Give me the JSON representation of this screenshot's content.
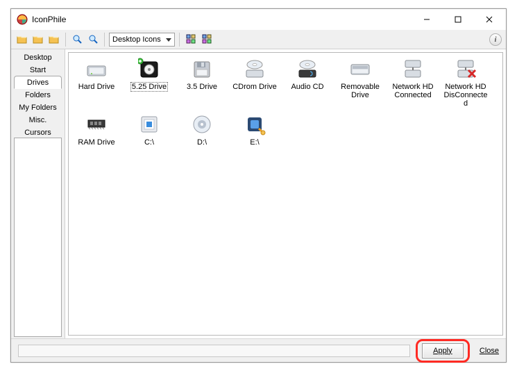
{
  "window": {
    "title": "IconPhile",
    "buttons": {
      "minimize": "Minimize",
      "maximize": "Maximize",
      "close": "Close"
    }
  },
  "toolbar": {
    "dropdown_value": "Desktop Icons",
    "help": "i",
    "icons": [
      "folder-open",
      "folder-open2",
      "folder-open3",
      "search",
      "magnifier",
      "grid-toggle",
      "options"
    ]
  },
  "sidebar": {
    "tabs": [
      {
        "label": "Desktop",
        "active": false
      },
      {
        "label": "Start",
        "active": false
      },
      {
        "label": "Drives",
        "active": true
      },
      {
        "label": "Folders",
        "active": false
      },
      {
        "label": "My Folders",
        "active": false
      },
      {
        "label": "Misc.",
        "active": false
      },
      {
        "label": "Cursors",
        "active": false
      }
    ]
  },
  "items": [
    {
      "label": "Hard Drive",
      "icon": "hard-drive",
      "selected": false
    },
    {
      "label": "5.25 Drive",
      "icon": "floppy-525",
      "selected": true
    },
    {
      "label": "3.5 Drive",
      "icon": "floppy-35",
      "selected": false
    },
    {
      "label": "CDrom Drive",
      "icon": "cdrom",
      "selected": false
    },
    {
      "label": "Audio CD",
      "icon": "audio-cd",
      "selected": false
    },
    {
      "label": "Removable Drive",
      "icon": "removable",
      "selected": false
    },
    {
      "label": "Network HD Connected",
      "icon": "net-hd",
      "selected": false
    },
    {
      "label": "Network HD DisConnected",
      "icon": "net-hd-off",
      "selected": false
    },
    {
      "label": "RAM Drive",
      "icon": "ram",
      "selected": false
    },
    {
      "label": "C:\\",
      "icon": "drive-c",
      "selected": false
    },
    {
      "label": "D:\\",
      "icon": "drive-d",
      "selected": false
    },
    {
      "label": "E:\\",
      "icon": "drive-e",
      "selected": false
    }
  ],
  "footer": {
    "apply": "Apply",
    "close": "Close"
  }
}
